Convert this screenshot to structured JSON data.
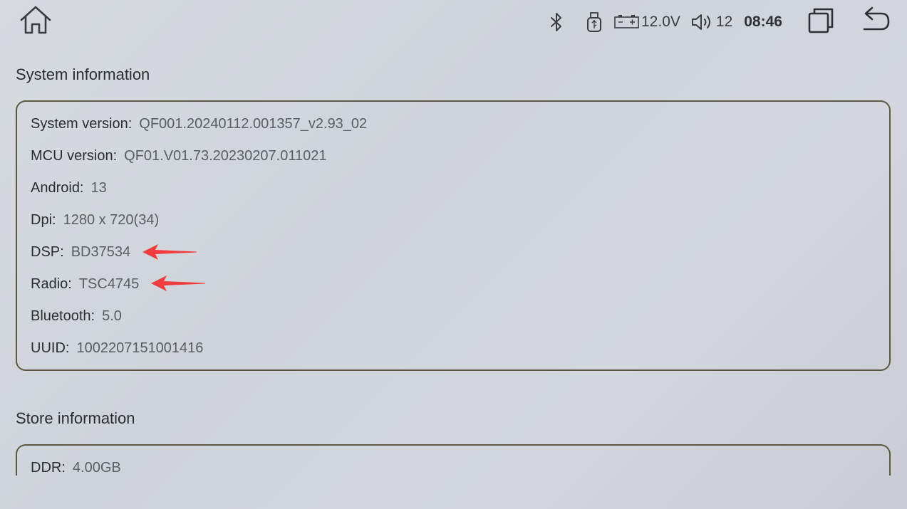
{
  "status_bar": {
    "voltage": "12.0V",
    "volume": "12",
    "time": "08:46",
    "icons": [
      "home-icon",
      "bluetooth-icon",
      "usb-icon",
      "battery-icon",
      "volume-icon",
      "recent-apps-icon",
      "back-icon"
    ]
  },
  "system_info": {
    "title": "System information",
    "rows": [
      {
        "label": "System version:",
        "value": "QF001.20240112.001357_v2.93_02"
      },
      {
        "label": "MCU version:",
        "value": "QF01.V01.73.20230207.011021"
      },
      {
        "label": "Android:",
        "value": "13"
      },
      {
        "label": "Dpi:",
        "value": "1280 x 720(34)"
      },
      {
        "label": "DSP:",
        "value": "BD37534"
      },
      {
        "label": "Radio:",
        "value": "TSC4745"
      },
      {
        "label": "Bluetooth:",
        "value": "5.0"
      },
      {
        "label": "UUID:",
        "value": "1002207151001416"
      }
    ]
  },
  "store_info": {
    "title": "Store information",
    "rows": [
      {
        "label": "DDR:",
        "value": "4.00GB"
      }
    ]
  },
  "colors": {
    "annotation_arrow": "#f03c3c",
    "card_border": "#5c5842"
  }
}
